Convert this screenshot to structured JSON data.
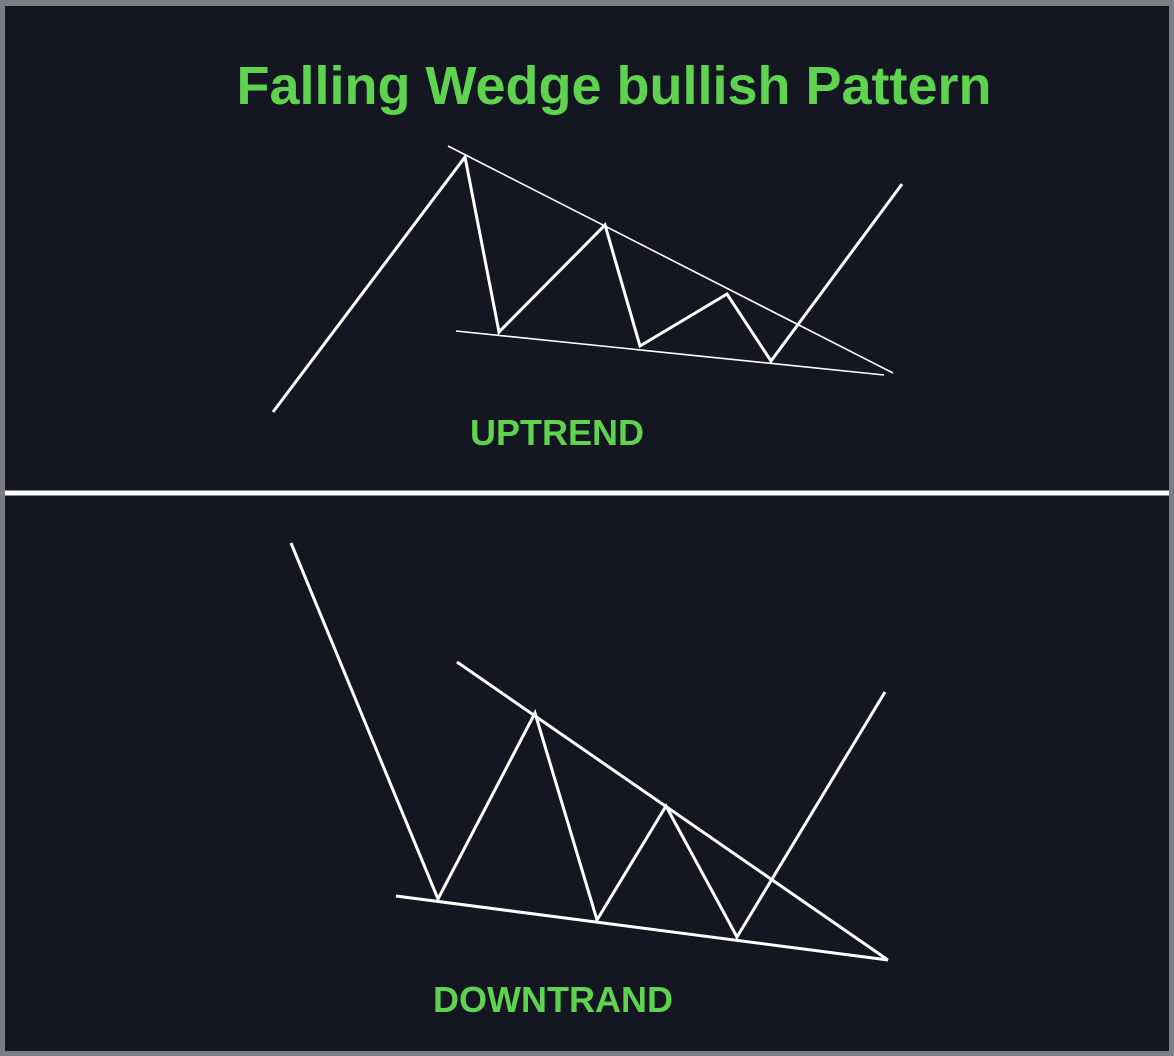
{
  "title": "Falling Wedge bullish Pattern",
  "panels": {
    "upper_label": "UPTREND",
    "lower_label": "DOWNTRAND"
  },
  "colors": {
    "background": "#141722",
    "text": "#5fd34f",
    "lines": "#ffffff"
  }
}
